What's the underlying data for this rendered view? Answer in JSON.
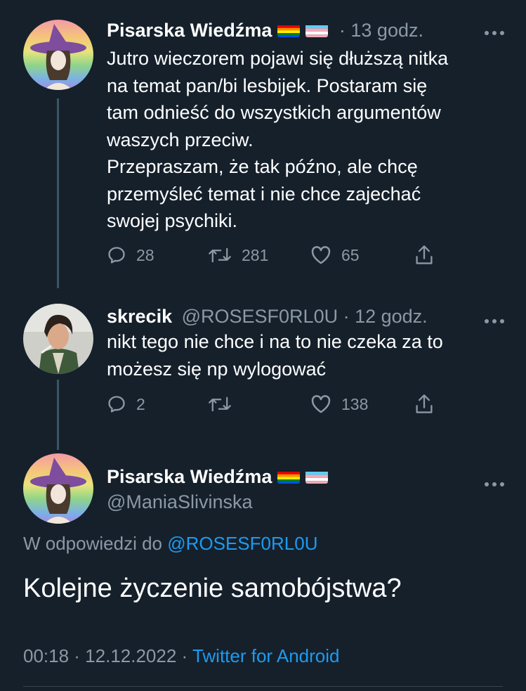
{
  "tweets": [
    {
      "author_name": "Pisarska Wiedźma",
      "time": "· 13 godz.",
      "text": "Jutro wieczorem pojawi się dłuższą nitka\nna temat pan/bi lesbijek. Postaram się\ntam odnieść do wszystkich argumentów\nwaszych przeciw.\nPrzepraszam, że tak późno, ale chcę\nprzemyśleć temat i nie chce zajechać\nswojej psychiki.",
      "replies": "28",
      "retweets": "281",
      "likes": "65"
    },
    {
      "author_name": "skrecik",
      "handle_time": "@ROSESF0RL0U · 12 godz.",
      "text": "nikt tego nie chce i na to nie czeka za to\nmożesz się np wylogować",
      "replies": "2",
      "retweets": "",
      "likes": "138"
    }
  ],
  "main_tweet": {
    "author_name": "Pisarska Wiedźma",
    "handle": "@ManiaSlivinska",
    "reply_prefix": "W odpowiedzi do",
    "reply_to": "@ROSESF0RL0U",
    "text": "Kolejne życzenie samobójstwa?",
    "time_date": "00:18 · 12.12.2022 ·",
    "source": "Twitter for Android"
  },
  "icons": {
    "more": "more-horizontal-icon",
    "reply": "reply-icon",
    "retweet": "retweet-icon",
    "like": "heart-icon",
    "share": "share-icon",
    "flags": [
      "rainbow-flag-icon",
      "transgender-flag-icon"
    ]
  },
  "colors": {
    "background": "#15202b",
    "secondary_text": "#8b98a5",
    "link": "#1d9bf0",
    "thread_line": "#3d5466"
  }
}
